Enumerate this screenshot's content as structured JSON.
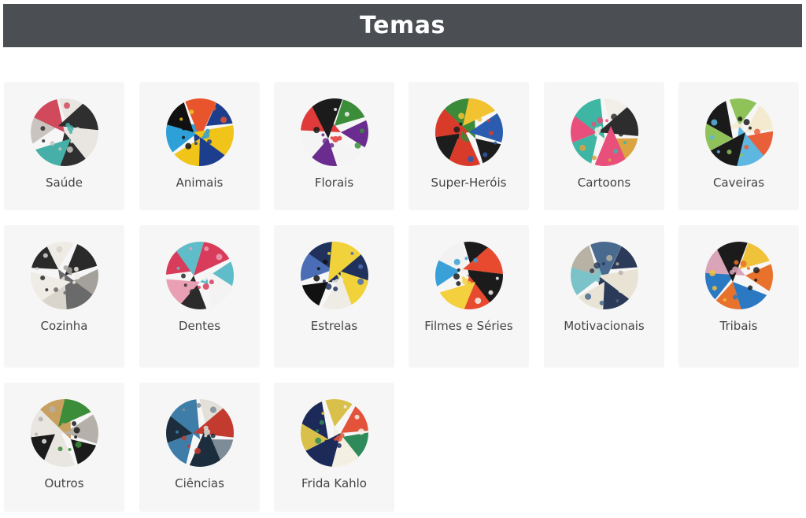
{
  "header": {
    "title": "Temas"
  },
  "themes": [
    {
      "label": "Saúde",
      "icon": "health-fabric-thumbnail",
      "colors": [
        "#e9e6e2",
        "#2f2f2f",
        "#46b0a8",
        "#c9c4bf",
        "#d04a5c"
      ]
    },
    {
      "label": "Animais",
      "icon": "animals-fabric-thumbnail",
      "colors": [
        "#1c3e8c",
        "#f0c419",
        "#2ea0d8",
        "#111111",
        "#e8552d"
      ]
    },
    {
      "label": "Florais",
      "icon": "floral-fabric-thumbnail",
      "colors": [
        "#6a2c8e",
        "#f4f4f4",
        "#e03a3a",
        "#1b1b1b",
        "#3c8d3a"
      ]
    },
    {
      "label": "Super-Heróis",
      "icon": "superheroes-fabric-thumbnail",
      "colors": [
        "#1d1d1d",
        "#d93b2b",
        "#3a8a3a",
        "#f2c230",
        "#2a5db0"
      ]
    },
    {
      "label": "Cartoons",
      "icon": "cartoons-fabric-thumbnail",
      "colors": [
        "#e84f7a",
        "#3fb5a4",
        "#f2efe8",
        "#2d2d2d",
        "#d9a441"
      ]
    },
    {
      "label": "Caveiras",
      "icon": "skulls-fabric-thumbnail",
      "colors": [
        "#1a1a1a",
        "#8fc35a",
        "#f3ead0",
        "#e95f3a",
        "#5db7e0"
      ]
    },
    {
      "label": "Cozinha",
      "icon": "kitchen-fabric-thumbnail",
      "colors": [
        "#efece6",
        "#2a2a2a",
        "#a4a09a",
        "#6a6a6a",
        "#d9d4cc"
      ]
    },
    {
      "label": "Dentes",
      "icon": "teeth-fabric-thumbnail",
      "colors": [
        "#d93b5a",
        "#5fbcc9",
        "#f3f3f3",
        "#2b2b2b",
        "#e9a0b5"
      ]
    },
    {
      "label": "Estrelas",
      "icon": "stars-fabric-thumbnail",
      "colors": [
        "#20325c",
        "#f2d23a",
        "#efece6",
        "#111111",
        "#4a6db5"
      ]
    },
    {
      "label": "Filmes e Séries",
      "icon": "movies-series-fabric-thumbnail",
      "colors": [
        "#1b1b1b",
        "#e84a2f",
        "#f4d03f",
        "#3aa0d8",
        "#f2f2f2"
      ]
    },
    {
      "label": "Motivacionais",
      "icon": "motivational-fabric-thumbnail",
      "colors": [
        "#2a3a58",
        "#e9e3d6",
        "#7cc3c9",
        "#b8b2a5",
        "#49698f"
      ]
    },
    {
      "label": "Tribais",
      "icon": "tribal-fabric-thumbnail",
      "colors": [
        "#e8712b",
        "#2a79c2",
        "#d9a3b8",
        "#1b1b1b",
        "#f0c23a"
      ]
    },
    {
      "label": "Outros",
      "icon": "other-fabric-thumbnail",
      "colors": [
        "#1b1b1b",
        "#e9e6e2",
        "#c8a060",
        "#3c8d3a",
        "#b5b0aa"
      ]
    },
    {
      "label": "Ciências",
      "icon": "science-fabric-thumbnail",
      "colors": [
        "#1c2e3e",
        "#3d7da8",
        "#e2e0d8",
        "#c23b2e",
        "#7d8c96"
      ]
    },
    {
      "label": "Frida Kahlo",
      "icon": "frida-kahlo-fabric-thumbnail",
      "colors": [
        "#1c2a5a",
        "#d9c04a",
        "#e2533a",
        "#2e8a5a",
        "#f3efe2"
      ]
    }
  ]
}
